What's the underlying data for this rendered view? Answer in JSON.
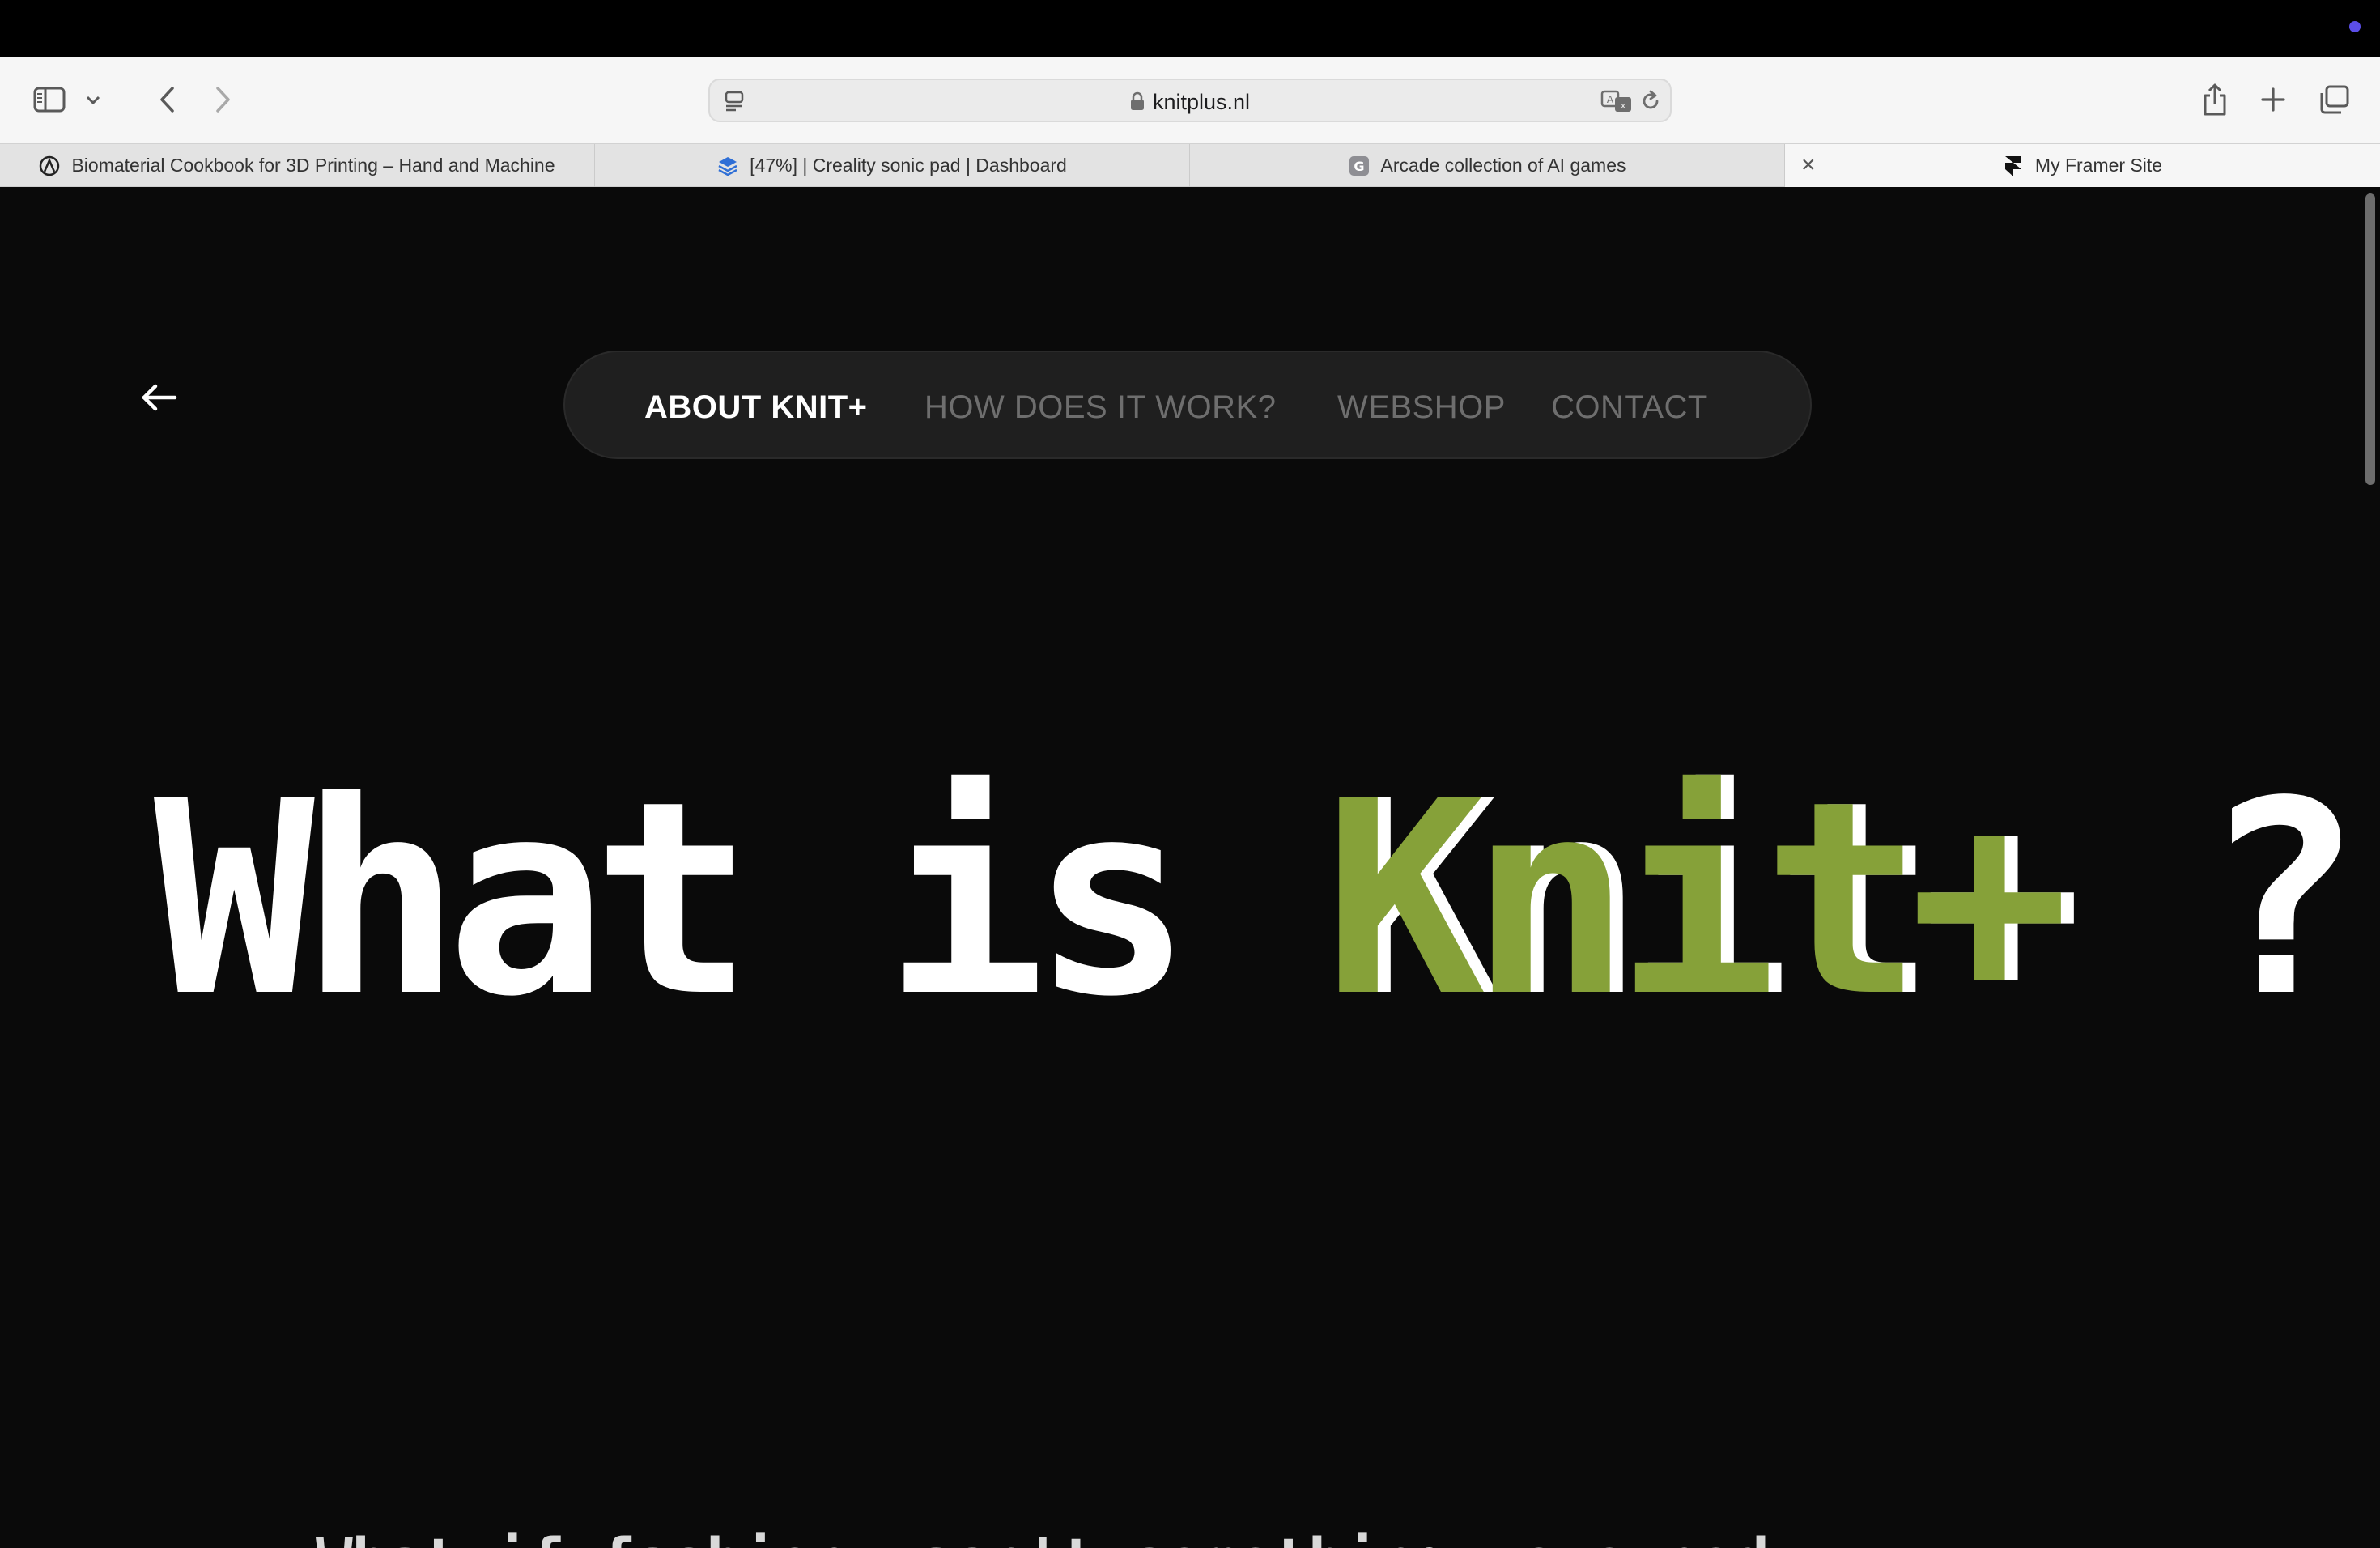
{
  "browser": {
    "url": "knitplus.nl",
    "tabs": [
      {
        "title": "Biomaterial Cookbook for 3D Printing – Hand and Machine",
        "favicon": "hand-icon"
      },
      {
        "title": "[47%] | Creality sonic pad | Dashboard",
        "favicon": "layers-icon"
      },
      {
        "title": "Arcade collection of AI games",
        "favicon": "g-letter-icon"
      },
      {
        "title": "My Framer Site",
        "favicon": "framer-icon"
      }
    ],
    "colors": {
      "toolbar": "#f6f6f6",
      "tabbar": "#e3e3e3",
      "recording_dot": "#5b4ee8"
    }
  },
  "site": {
    "nav": {
      "items": [
        "ABOUT KNIT+",
        "HOW DOES IT WORK?",
        "WEBSHOP",
        "CONTACT"
      ],
      "active": "ABOUT KNIT+"
    },
    "headline": {
      "before": "What is ",
      "accent": "Knit+",
      "after": " ?"
    },
    "subline": "What if fashion wasn't something we owned",
    "colors": {
      "background": "#0a0a0a",
      "accent": "#86a139",
      "nav_pill": "#1f1f1f"
    }
  }
}
